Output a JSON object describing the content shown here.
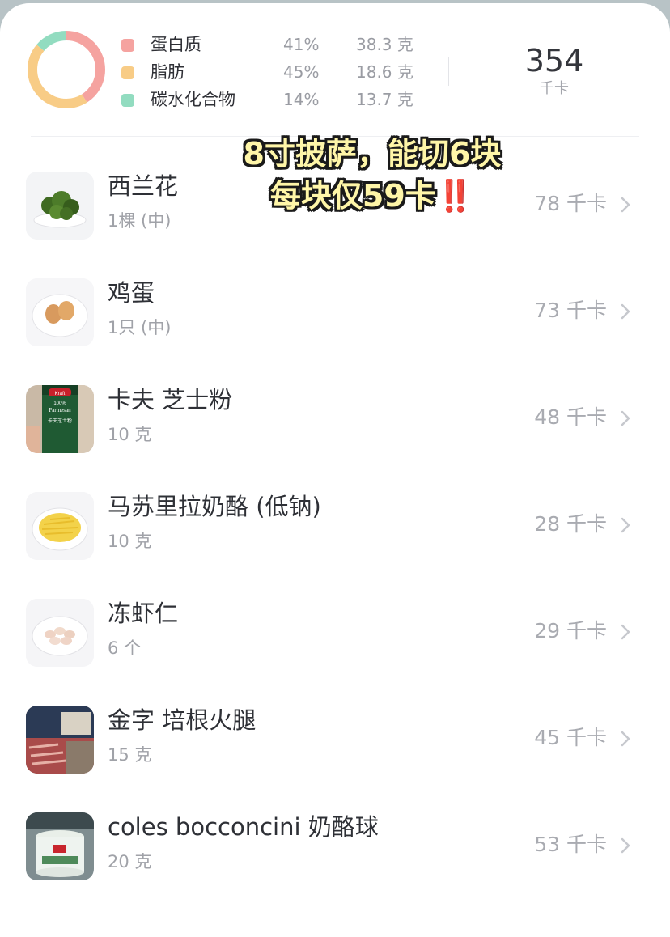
{
  "summary": {
    "macros": [
      {
        "name": "蛋白质",
        "percent": "41%",
        "grams": "38.3 克",
        "color": "#f5a3a0"
      },
      {
        "name": "脂肪",
        "percent": "45%",
        "grams": "18.6 克",
        "color": "#f8cc86"
      },
      {
        "name": "碳水化合物",
        "percent": "14%",
        "grams": "13.7 克",
        "color": "#92dcc0"
      }
    ],
    "total_kcal": "354",
    "total_unit": "千卡"
  },
  "overlay": {
    "line1": "8寸披萨，能切6块",
    "line2": "每块仅59卡",
    "emoji": "‼️"
  },
  "foods": [
    {
      "name": "西兰花",
      "qty": "1棵 (中)",
      "kcal": "78 千卡",
      "thumb": "broccoli-image"
    },
    {
      "name": "鸡蛋",
      "qty": "1只 (中)",
      "kcal": "73 千卡",
      "thumb": "egg-image"
    },
    {
      "name": "卡夫 芝士粉",
      "qty": "10 克",
      "kcal": "48 千卡",
      "thumb": "parmesan-bottle-image",
      "thumb_text": [
        "Kraft",
        "100%",
        "Parmesan",
        "卡夫芝士粉"
      ]
    },
    {
      "name": "马苏里拉奶酪 (低钠)",
      "qty": "10 克",
      "kcal": "28 千卡",
      "thumb": "shredded-cheese-image"
    },
    {
      "name": "冻虾仁",
      "qty": "6 个",
      "kcal": "29 千卡",
      "thumb": "shrimp-image"
    },
    {
      "name": "金字 培根火腿",
      "qty": "15 克",
      "kcal": "45 千卡",
      "thumb": "bacon-package-image"
    },
    {
      "name": "coles bocconcini 奶酪球",
      "qty": "20 克",
      "kcal": "53 千卡",
      "thumb": "bocconcini-tub-image"
    }
  ],
  "colors": {
    "protein": "#f5a3a0",
    "fat": "#f8cc86",
    "carbs": "#92dcc0",
    "overlay_text": "#fff6a8"
  }
}
